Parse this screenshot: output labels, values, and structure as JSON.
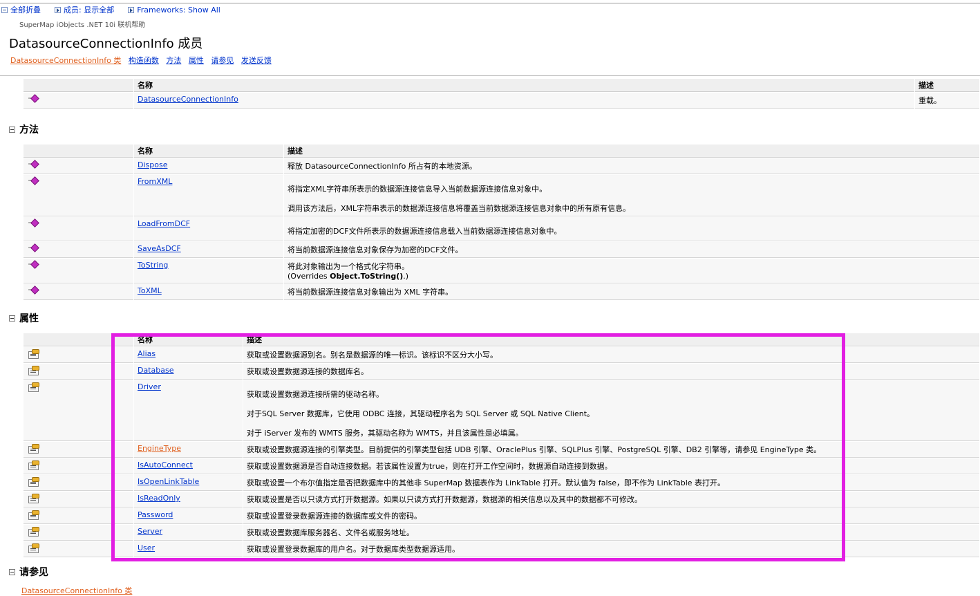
{
  "topbar": {
    "collapse_all": "全部折叠",
    "members": "成员: 显示全部",
    "frameworks": "Frameworks: Show All"
  },
  "product": "SuperMap iObjects .NET 10i 联机帮助",
  "page_title": "DatasourceConnectionInfo 成员",
  "subnav": [
    "DatasourceConnectionInfo 类",
    "构造函数",
    "方法",
    "属性",
    "请参见",
    "发送反馈"
  ],
  "constructors_table": {
    "headers": [
      "名称",
      "描述"
    ],
    "rows": [
      {
        "name": "DatasourceConnectionInfo",
        "desc": "重载。"
      }
    ]
  },
  "methods_section": {
    "title": "方法",
    "headers": [
      "名称",
      "描述"
    ],
    "rows": [
      {
        "name": "Dispose",
        "desc": [
          "释放 DatasourceConnectionInfo 所占有的本地资源。"
        ]
      },
      {
        "name": "FromXML",
        "desc": [
          "将指定XML字符串所表示的数据源连接信息导入当前数据源连接信息对象中。",
          "调用该方法后，XML字符串表示的数据源连接信息将覆盖当前数据源连接信息对象中的所有原有信息。"
        ]
      },
      {
        "name": "LoadFromDCF",
        "desc": [
          "将指定加密的DCF文件所表示的数据源连接信息载入当前数据源连接信息对象中。"
        ]
      },
      {
        "name": "SaveAsDCF",
        "desc": [
          "将当前数据源连接信息对象保存为加密的DCF文件。"
        ]
      },
      {
        "name": "ToString",
        "desc": [
          "将此对象输出为一个格式化字符串。"
        ],
        "override_prefix": "(Overrides ",
        "override_name": "Object.ToString()",
        "override_suffix": ".)"
      },
      {
        "name": "ToXML",
        "desc": [
          "将当前数据源连接信息对象输出为 XML 字符串。"
        ]
      }
    ]
  },
  "properties_section": {
    "title": "属性",
    "headers": [
      "名称",
      "描述"
    ],
    "rows": [
      {
        "name": "Alias",
        "desc": [
          "获取或设置数据源别名。别名是数据源的唯一标识。该标识不区分大小写。"
        ]
      },
      {
        "name": "Database",
        "desc": [
          "获取或设置数据源连接的数据库名。"
        ]
      },
      {
        "name": "Driver",
        "desc": [
          "获取或设置数据源连接所需的驱动名称。",
          "对于SQL Server 数据库，它使用 ODBC 连接，其驱动程序名为 SQL Server 或 SQL Native Client。",
          "对于 iServer 发布的 WMTS 服务，其驱动名称为 WMTS，并且该属性是必填属。"
        ]
      },
      {
        "name": "EngineType",
        "visited": true,
        "desc": [
          "获取或设置数据源连接的引擎类型。目前提供的引擎类型包括 UDB 引擎、OraclePlus 引擎、SQLPlus 引擎、PostgreSQL 引擎、DB2 引擎等，请参见 EngineType 类。"
        ]
      },
      {
        "name": "IsAutoConnect",
        "desc": [
          "获取或设置数据源是否自动连接数据。若该属性设置为true，则在打开工作空间时，数据源自动连接到数据。"
        ]
      },
      {
        "name": "IsOpenLinkTable",
        "desc": [
          "获取或设置一个布尔值指定是否把数据库中的其他非 SuperMap 数据表作为 LinkTable 打开。默认值为 false，即不作为 LinkTable 表打开。"
        ]
      },
      {
        "name": "IsReadOnly",
        "desc": [
          "获取或设置是否以只读方式打开数据源。如果以只读方式打开数据源，数据源的相关信息以及其中的数据都不可修改。"
        ]
      },
      {
        "name": "Password",
        "desc": [
          "获取或设置登录数据源连接的数据库或文件的密码。"
        ]
      },
      {
        "name": "Server",
        "desc": [
          "获取或设置数据库服务器名、文件名或服务地址。"
        ]
      },
      {
        "name": "User",
        "desc": [
          "获取或设置登录数据库的用户名。对于数据库类型数据源适用。"
        ]
      }
    ]
  },
  "see_also_section": {
    "title": "请参见",
    "link": "DatasourceConnectionInfo 类"
  },
  "colors": {
    "link": "#0033cc",
    "visited_link": "#e0601f",
    "highlight_border": "#e21fe2"
  },
  "icons": {
    "method": "method-icon",
    "property": "property-icon"
  }
}
